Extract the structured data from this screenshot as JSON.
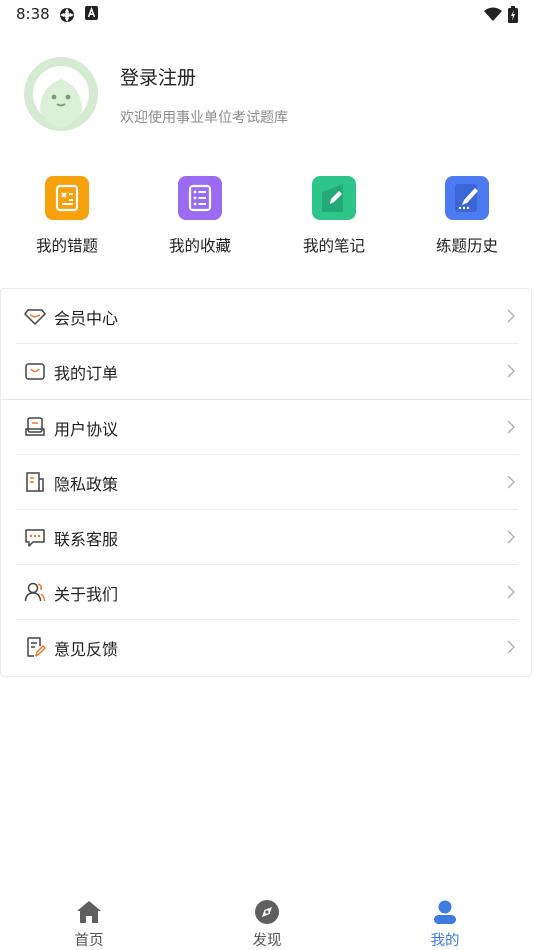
{
  "status_bar": {
    "time": "8:38"
  },
  "profile": {
    "title": "登录注册",
    "subtitle": "欢迎使用事业单位考试题库"
  },
  "quick_actions": [
    {
      "label": "我的错题",
      "icon": "wrong-questions-icon",
      "color": "#F7A20C"
    },
    {
      "label": "我的收藏",
      "icon": "favorites-icon",
      "color": "#9B6CF2"
    },
    {
      "label": "我的笔记",
      "icon": "notes-icon",
      "color": "#2DC58A"
    },
    {
      "label": "练题历史",
      "icon": "practice-history-icon",
      "color": "#4C7AF2"
    }
  ],
  "menu": [
    {
      "label": "会员中心",
      "icon": "diamond-icon"
    },
    {
      "label": "我的订单",
      "icon": "shopping-bag-icon"
    },
    {
      "label": "用户协议",
      "icon": "agreement-icon"
    },
    {
      "label": "隐私政策",
      "icon": "privacy-document-icon"
    },
    {
      "label": "联系客服",
      "icon": "chat-bubble-icon"
    },
    {
      "label": "关于我们",
      "icon": "users-icon"
    },
    {
      "label": "意见反馈",
      "icon": "feedback-icon"
    }
  ],
  "tabbar": {
    "items": [
      {
        "label": "首页",
        "icon": "home-icon"
      },
      {
        "label": "发现",
        "icon": "compass-icon"
      },
      {
        "label": "我的",
        "icon": "profile-icon"
      }
    ],
    "active_color": "#3D7BE0"
  }
}
